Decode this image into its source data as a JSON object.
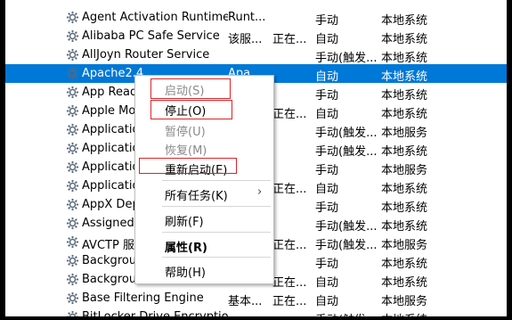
{
  "services": [
    {
      "name": "Agent Activation Runtime...",
      "desc": "Runt...",
      "status": "",
      "startup": "手动",
      "logon": "本地系统",
      "selected": false
    },
    {
      "name": "Alibaba PC Safe Service",
      "desc": "该服...",
      "status": "正在...",
      "startup": "自动",
      "logon": "本地系统",
      "selected": false
    },
    {
      "name": "AllJoyn Router Service",
      "desc": "",
      "status": "",
      "startup": "手动(触发...",
      "logon": "本地系统",
      "selected": false
    },
    {
      "name": "Apache2.4",
      "desc": "Apa...",
      "status": "",
      "startup": "自动",
      "logon": "本地系统",
      "selected": true
    },
    {
      "name": "App Readiness",
      "desc": "",
      "status": "",
      "startup": "手动",
      "logon": "本地系统",
      "selected": false
    },
    {
      "name": "Apple Mobile Device Service",
      "desc": "",
      "status": "正在...",
      "startup": "自动",
      "logon": "本地系统",
      "selected": false
    },
    {
      "name": "Application Identity",
      "desc": "",
      "status": "",
      "startup": "手动(触发...",
      "logon": "本地服务",
      "selected": false
    },
    {
      "name": "Application Information",
      "desc": "",
      "status": "",
      "startup": "手动(触发...",
      "logon": "本地系统",
      "selected": false
    },
    {
      "name": "Application Layer Gateway",
      "desc": "",
      "status": "",
      "startup": "手动",
      "logon": "本地服务",
      "selected": false
    },
    {
      "name": "Application Management",
      "desc": "",
      "status": "正在...",
      "startup": "自动",
      "logon": "本地系统",
      "selected": false
    },
    {
      "name": "AppX Deployment Service",
      "desc": "",
      "status": "",
      "startup": "手动",
      "logon": "本地系统",
      "selected": false
    },
    {
      "name": "Assigned Access Manager",
      "desc": "",
      "status": "",
      "startup": "手动(触发...",
      "logon": "本地系统",
      "selected": false
    },
    {
      "name": "AVCTP 服务",
      "desc": "",
      "status": "正在...",
      "startup": "手动(触发...",
      "logon": "本地服务",
      "selected": false
    },
    {
      "name": "Background Intelligent...",
      "desc": "",
      "status": "",
      "startup": "手动",
      "logon": "本地系统",
      "selected": false
    },
    {
      "name": "Background Tasks Infrastr...",
      "desc": "",
      "status": "正在...",
      "startup": "自动",
      "logon": "本地系统",
      "selected": false
    },
    {
      "name": "Base Filtering Engine",
      "desc": "基本...",
      "status": "正在...",
      "startup": "自动",
      "logon": "本地服务",
      "selected": false
    },
    {
      "name": "BitLocker Drive Encryption...",
      "desc": "",
      "status": "",
      "startup": "手动(触发...",
      "logon": "本地系统",
      "selected": false
    }
  ],
  "context_menu": {
    "start": "启动(S)",
    "stop": "停止(O)",
    "pause": "暂停(U)",
    "resume": "恢复(M)",
    "restart": "重新启动(E)",
    "all_tasks": "所有任务(K)",
    "all_tasks_arrow": "›",
    "refresh": "刷新(F)",
    "properties": "属性(R)",
    "help": "帮助(H)"
  }
}
